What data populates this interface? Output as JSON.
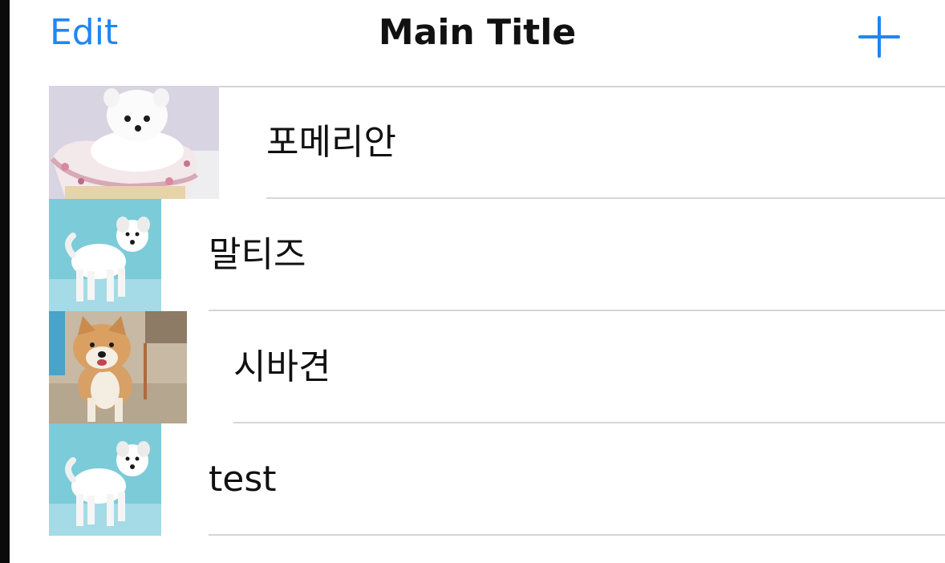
{
  "navbar": {
    "edit_label": "Edit",
    "title": "Main Title",
    "add_icon": "plus-icon",
    "accent_color": "#1f87f3"
  },
  "rows": [
    {
      "label": "포메리안",
      "image": "pomeranian-in-basket-photo"
    },
    {
      "label": "말티즈",
      "image": "maltese-dog-photo"
    },
    {
      "label": "시바견",
      "image": "shiba-inu-dog-photo"
    },
    {
      "label": "test",
      "image": "maltese-dog-photo"
    }
  ]
}
